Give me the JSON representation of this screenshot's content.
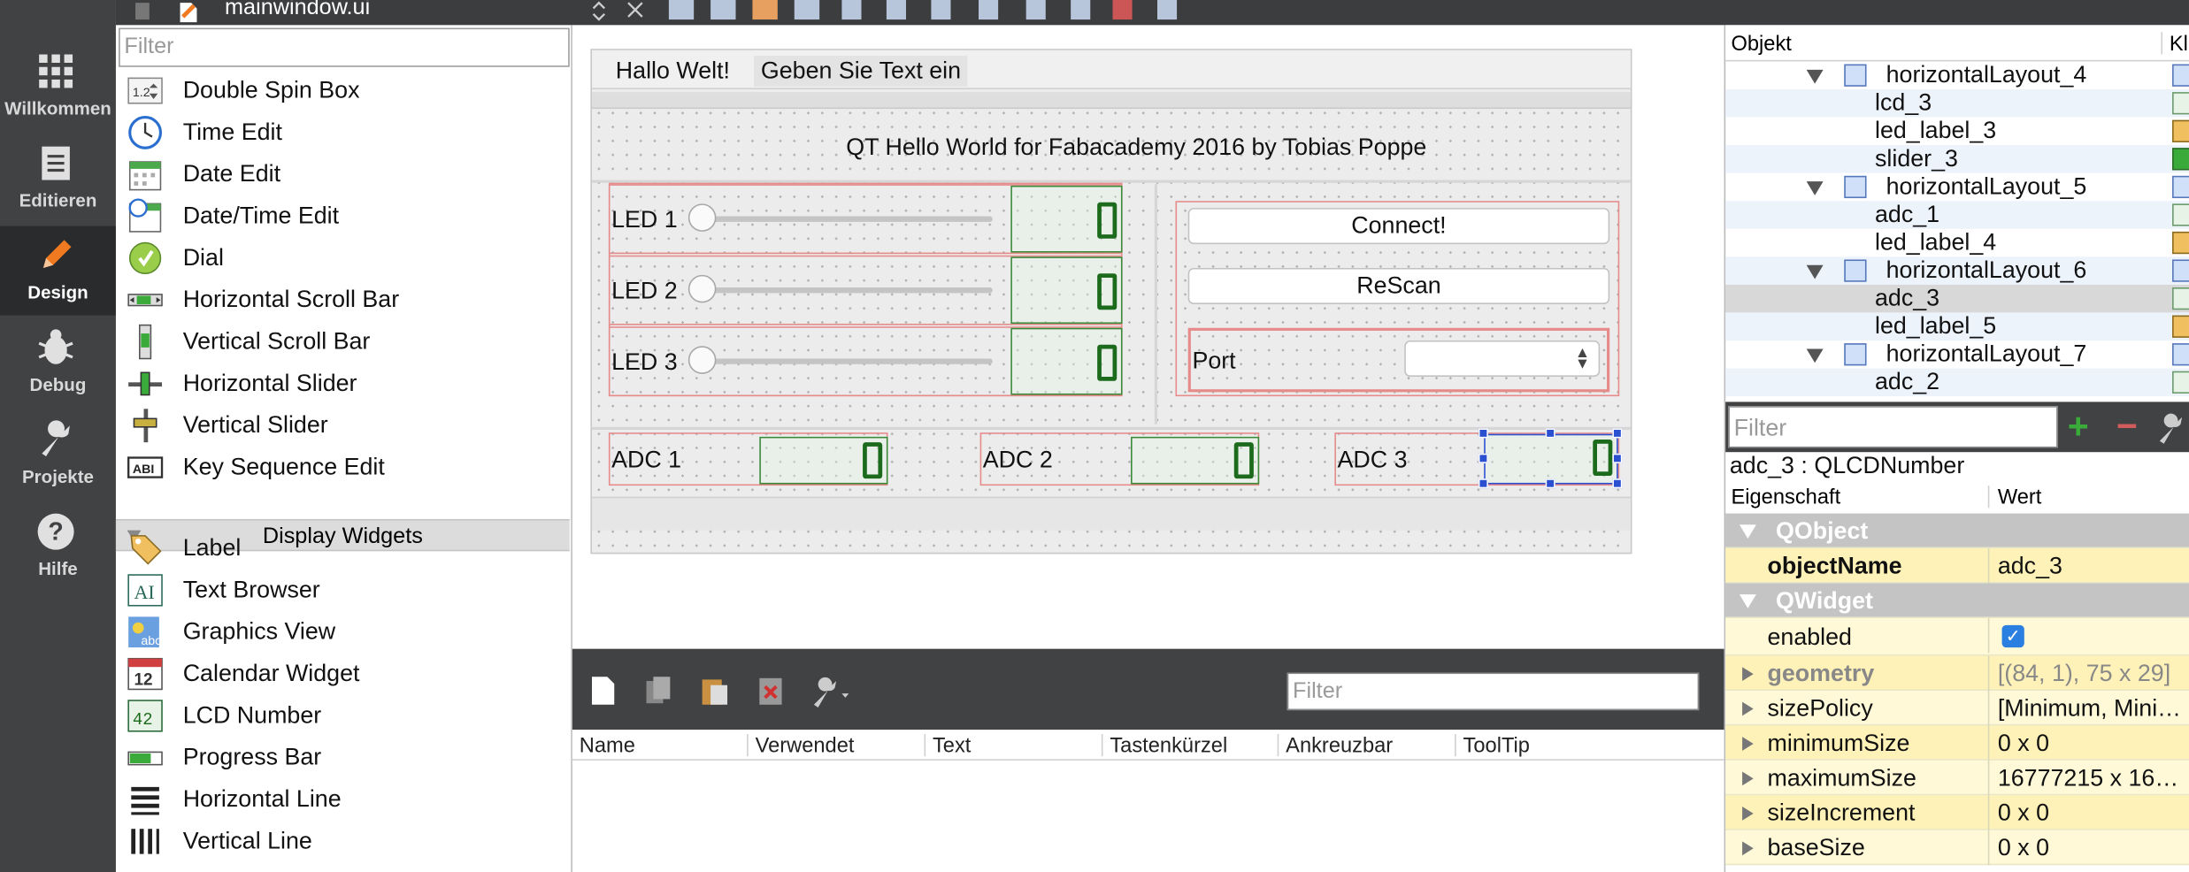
{
  "file_tab": {
    "name": "mainwindow.ui"
  },
  "modes": [
    {
      "label": "Willkommen",
      "icon": "grid-icon"
    },
    {
      "label": "Editieren",
      "icon": "document-icon"
    },
    {
      "label": "Design",
      "icon": "pencil-icon"
    },
    {
      "label": "Debug",
      "icon": "bug-icon"
    },
    {
      "label": "Projekte",
      "icon": "wrench-icon"
    },
    {
      "label": "Hilfe",
      "icon": "help-icon"
    }
  ],
  "widget_box": {
    "filter_placeholder": "Filter",
    "input_items": [
      {
        "label": "Double Spin Box",
        "icon": "double-spin-box-icon"
      },
      {
        "label": "Time Edit",
        "icon": "clock-icon"
      },
      {
        "label": "Date Edit",
        "icon": "calendar-icon"
      },
      {
        "label": "Date/Time Edit",
        "icon": "calendar-clock-icon"
      },
      {
        "label": "Dial",
        "icon": "dial-icon"
      },
      {
        "label": "Horizontal Scroll Bar",
        "icon": "horizontal-scroll-bar-icon"
      },
      {
        "label": "Vertical Scroll Bar",
        "icon": "vertical-scroll-bar-icon"
      },
      {
        "label": "Horizontal Slider",
        "icon": "horizontal-slider-icon"
      },
      {
        "label": "Vertical Slider",
        "icon": "vertical-slider-icon"
      },
      {
        "label": "Key Sequence Edit",
        "icon": "key-sequence-icon"
      }
    ],
    "display_category": "Display Widgets",
    "display_items": [
      {
        "label": "Label",
        "icon": "label-tag-icon"
      },
      {
        "label": "Text Browser",
        "icon": "text-browser-icon"
      },
      {
        "label": "Graphics View",
        "icon": "graphics-view-icon"
      },
      {
        "label": "Calendar Widget",
        "icon": "calendar-widget-icon"
      },
      {
        "label": "LCD Number",
        "icon": "lcd-number-icon"
      },
      {
        "label": "Progress Bar",
        "icon": "progress-bar-icon"
      },
      {
        "label": "Horizontal Line",
        "icon": "horizontal-line-icon"
      },
      {
        "label": "Vertical Line",
        "icon": "vertical-line-icon"
      }
    ]
  },
  "form": {
    "menus": [
      "Hallo Welt!",
      "Geben Sie Text ein"
    ],
    "title": "QT Hello World for Fabacademy 2016 by Tobias Poppe",
    "leds": [
      "LED 1",
      "LED 2",
      "LED 3"
    ],
    "led_lcd_value": "0",
    "connect_label": "Connect!",
    "rescan_label": "ReScan",
    "port_label": "Port",
    "adcs": [
      "ADC 1",
      "ADC 2",
      "ADC 3"
    ],
    "adc_lcd_value": "0"
  },
  "action_editor": {
    "filter_placeholder": "Filter",
    "columns": [
      "Name",
      "Verwendet",
      "Text",
      "Tastenkürzel",
      "Ankreuzbar",
      "ToolTip"
    ]
  },
  "object_inspector": {
    "columns": [
      "Objekt",
      "Kl"
    ],
    "rows": [
      {
        "name": "horizontalLayout_4",
        "type": "layout"
      },
      {
        "name": "lcd_3",
        "type": "child"
      },
      {
        "name": "led_label_3",
        "type": "child"
      },
      {
        "name": "slider_3",
        "type": "child"
      },
      {
        "name": "horizontalLayout_5",
        "type": "layout"
      },
      {
        "name": "adc_1",
        "type": "child"
      },
      {
        "name": "led_label_4",
        "type": "child"
      },
      {
        "name": "horizontalLayout_6",
        "type": "layout"
      },
      {
        "name": "adc_3",
        "type": "child",
        "selected": true
      },
      {
        "name": "led_label_5",
        "type": "child"
      },
      {
        "name": "horizontalLayout_7",
        "type": "layout"
      },
      {
        "name": "adc_2",
        "type": "child"
      }
    ]
  },
  "property_editor": {
    "filter_placeholder": "Filter",
    "class_label": "adc_3 : QLCDNumber",
    "columns": [
      "Eigenschaft",
      "Wert"
    ],
    "groups": {
      "qobject": "QObject",
      "qwidget": "QWidget"
    },
    "props": {
      "objectName": {
        "name": "objectName",
        "value": "adc_3"
      },
      "enabled": {
        "name": "enabled",
        "value": "✓"
      },
      "geometry": {
        "name": "geometry",
        "value": "[(84, 1), 75 x 29]"
      },
      "sizePolicy": {
        "name": "sizePolicy",
        "value": "[Minimum, Mini…"
      },
      "minimumSize": {
        "name": "minimumSize",
        "value": "0 x 0"
      },
      "maximumSize": {
        "name": "maximumSize",
        "value": "16777215 x 16…"
      },
      "sizeIncrement": {
        "name": "sizeIncrement",
        "value": "0 x 0"
      },
      "baseSize": {
        "name": "baseSize",
        "value": "0 x 0"
      }
    }
  },
  "colors": {
    "modebar": "#404244",
    "selection_handle": "#2a4fd0",
    "layout_outline": "#e68a8a",
    "lcd_digit": "#1c6b1c"
  }
}
